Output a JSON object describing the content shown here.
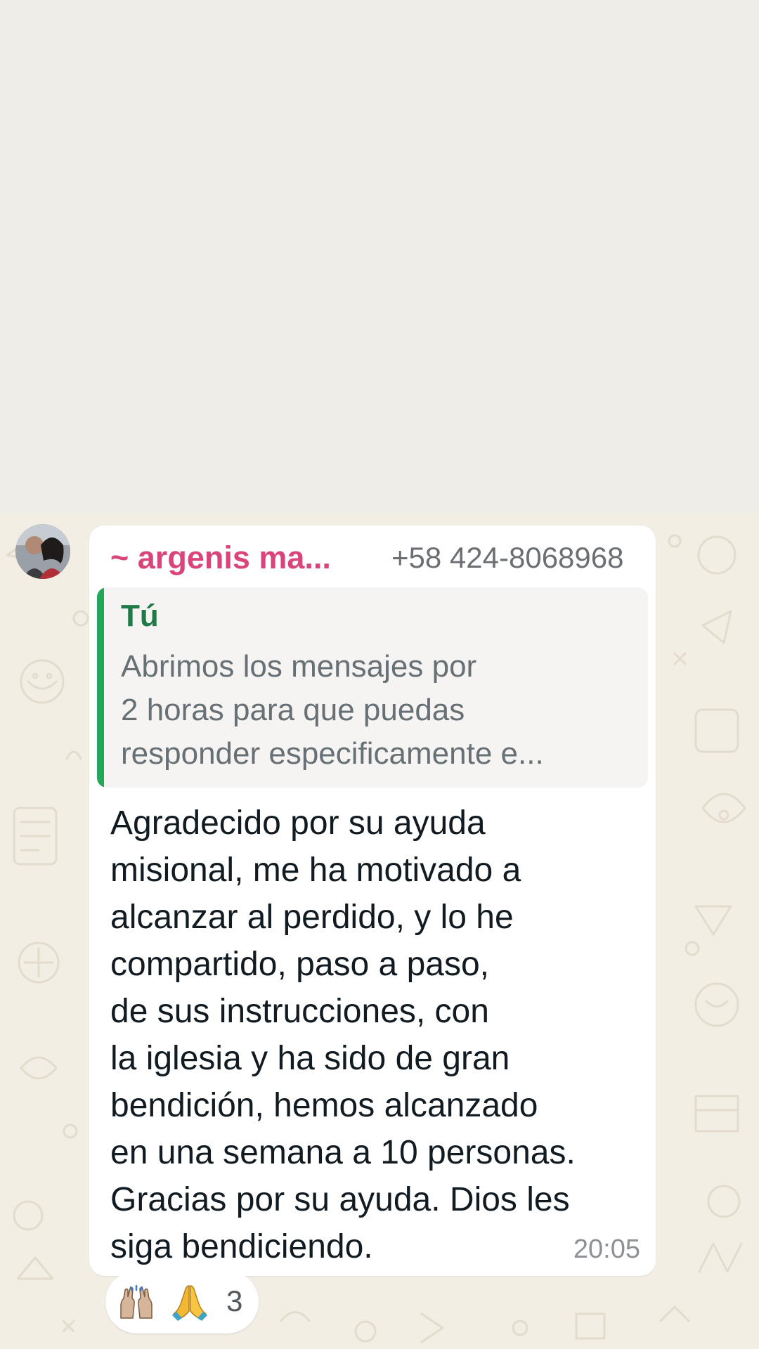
{
  "message": {
    "sender_name": "~ argenis ma...",
    "sender_phone": "+58 424-8068968",
    "quoted": {
      "author": "Tú",
      "lines": [
        "Abrimos los mensajes por",
        "2 horas para que puedas",
        "responder especificamente e..."
      ]
    },
    "body_lines": [
      "Agradecido por su ayuda",
      "misional, me ha motivado a",
      "alcanzar al perdido, y lo he",
      "compartido, paso a paso,",
      "de sus instrucciones, con",
      "la iglesia y ha sido de gran",
      "bendición, hemos alcanzado",
      "en una semana a 10 personas.",
      "Gracias por su ayuda. Dios les",
      "siga bendiciendo."
    ],
    "time": "20:05"
  },
  "reactions": {
    "emojis": [
      "raising-hands-icon",
      "folded-hands-icon"
    ],
    "count": "3"
  },
  "colors": {
    "sender_name": "#d9457a",
    "quote_bar": "#25a75a",
    "quote_author": "#1f7a48",
    "chat_background": "#f3eee4",
    "top_background": "#efede8"
  }
}
